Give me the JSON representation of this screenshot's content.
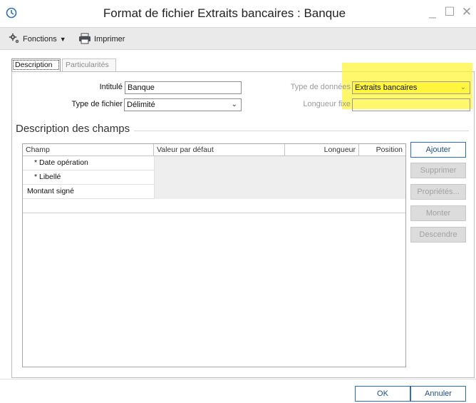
{
  "window": {
    "title": "Format de fichier Extraits bancaires : Banque",
    "controls": {
      "minimize": "_",
      "maximize": "☐",
      "close": "✕"
    }
  },
  "toolbar": {
    "functions_label": "Fonctions",
    "print_label": "Imprimer"
  },
  "tabs": [
    {
      "label": "Description",
      "selected": true
    },
    {
      "label": "Particularités",
      "selected": false
    }
  ],
  "form": {
    "intitule": {
      "label": "Intitulé",
      "value": "Banque"
    },
    "type_fichier": {
      "label": "Type de fichier",
      "value": "Délimité"
    },
    "type_donnees": {
      "label": "Type de données",
      "value": "Extraits bancaires",
      "enabled": false
    },
    "longueur_fixe": {
      "label": "Longueur fixe",
      "value": "",
      "enabled": false
    }
  },
  "section": {
    "title": "Description des champs"
  },
  "grid": {
    "columns": [
      "Champ",
      "Valeur par défaut",
      "Longueur",
      "Position"
    ],
    "rows": [
      {
        "champ": "* Date opération",
        "valeur": "",
        "longueur": "",
        "position": ""
      },
      {
        "champ": "* Libellé",
        "valeur": "",
        "longueur": "",
        "position": ""
      },
      {
        "champ": "Montant signé",
        "valeur": "",
        "longueur": "",
        "position": ""
      }
    ]
  },
  "side_buttons": {
    "add": "Ajouter",
    "delete": "Supprimer",
    "properties": "Propriétés...",
    "move_up": "Monter",
    "move_down": "Descendre"
  },
  "footer": {
    "ok": "OK",
    "cancel": "Annuler"
  },
  "colors": {
    "highlight": "#fff53c",
    "accent_border": "#2a6fbf",
    "toolbar_bg": "#eaeaea"
  },
  "icons": {
    "app": "app-clock-icon",
    "functions": "gear-icon",
    "print": "printer-icon",
    "dropdown": "chevron-down-icon"
  }
}
